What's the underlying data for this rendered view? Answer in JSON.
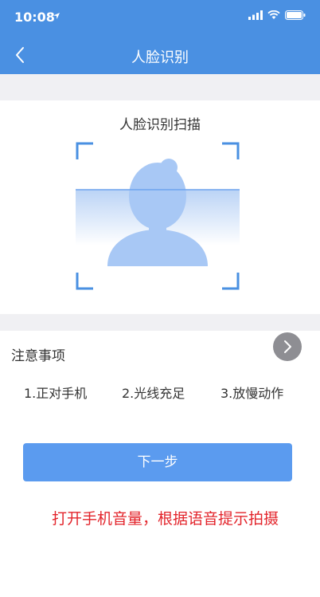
{
  "status_bar": {
    "time": "10:08"
  },
  "nav": {
    "title": "人脸识别"
  },
  "scan": {
    "title": "人脸识别扫描"
  },
  "notes": {
    "title": "注意事项",
    "items": [
      "1.正对手机",
      "2.光线充足",
      "3.放慢动作"
    ]
  },
  "next_button": {
    "label": "下一步"
  },
  "hint": {
    "text": "打开手机音量，根据语音提示拍摄"
  },
  "colors": {
    "primary": "#4a90e2",
    "button": "#5b9bef",
    "frame": "#4a90e2",
    "hint": "#e3242b"
  }
}
